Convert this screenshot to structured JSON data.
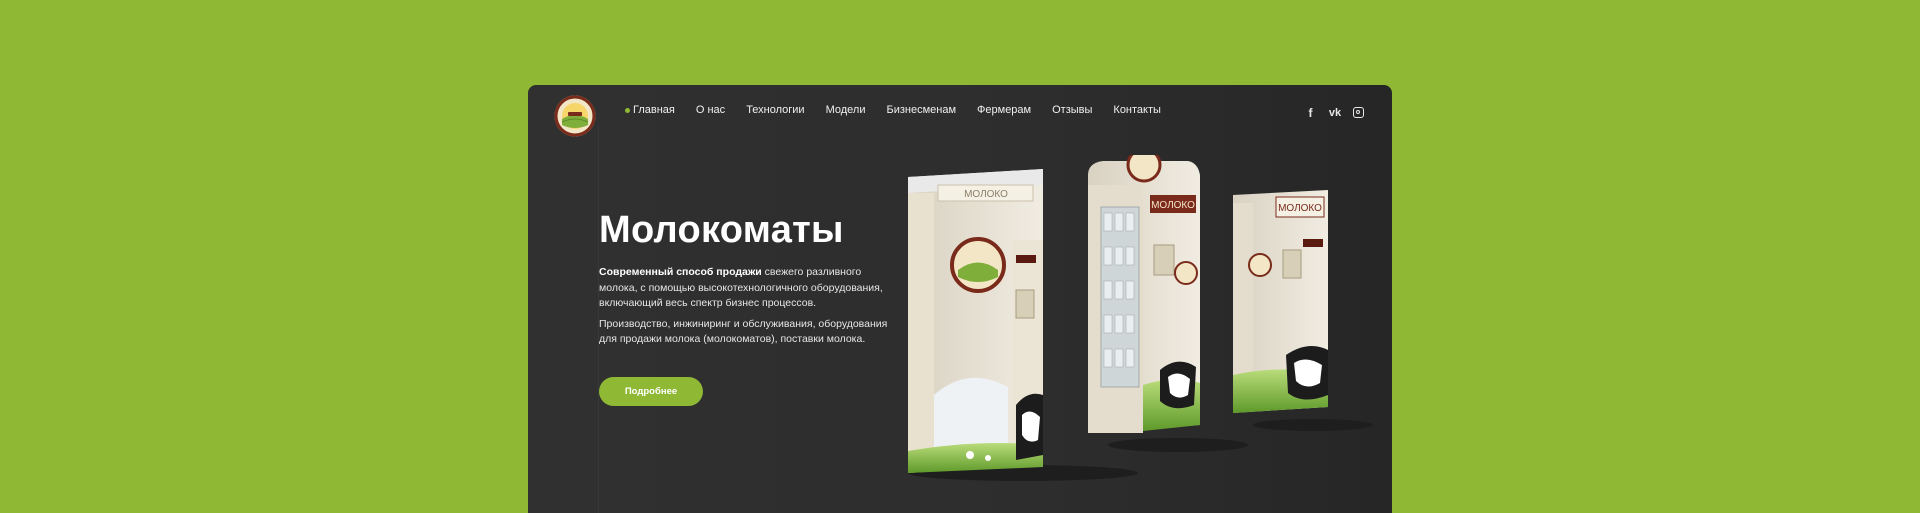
{
  "nav": {
    "items": [
      {
        "label": "Главная",
        "active": true
      },
      {
        "label": "О нас"
      },
      {
        "label": "Технологии"
      },
      {
        "label": "Модели"
      },
      {
        "label": "Бизнесменам"
      },
      {
        "label": "Фермерам"
      },
      {
        "label": "Отзывы"
      },
      {
        "label": "Контакты"
      }
    ]
  },
  "social": {
    "fb": "f",
    "vk": "vk",
    "icons": [
      "facebook-icon",
      "vk-icon",
      "instagram-icon"
    ]
  },
  "hero": {
    "title": "Молокоматы",
    "lead_bold": "Современный способ продажи",
    "lead_rest": " свежего разливного молока, с помощью высокотехнологичного оборудования, включающий весь спектр бизнес процессов.",
    "paragraph2": "Производство, инжиниринг и обслуживания, оборудования для продажи молока (молокоматов), поставки молока.",
    "button": "Подробнее"
  },
  "machines": {
    "label_left": "МОЛОКО",
    "label_center": "МОЛОКО",
    "label_right": "МОЛОКО"
  },
  "colors": {
    "accent": "#8fb835",
    "panel": "#2d2d2d",
    "text": "#ffffff"
  }
}
